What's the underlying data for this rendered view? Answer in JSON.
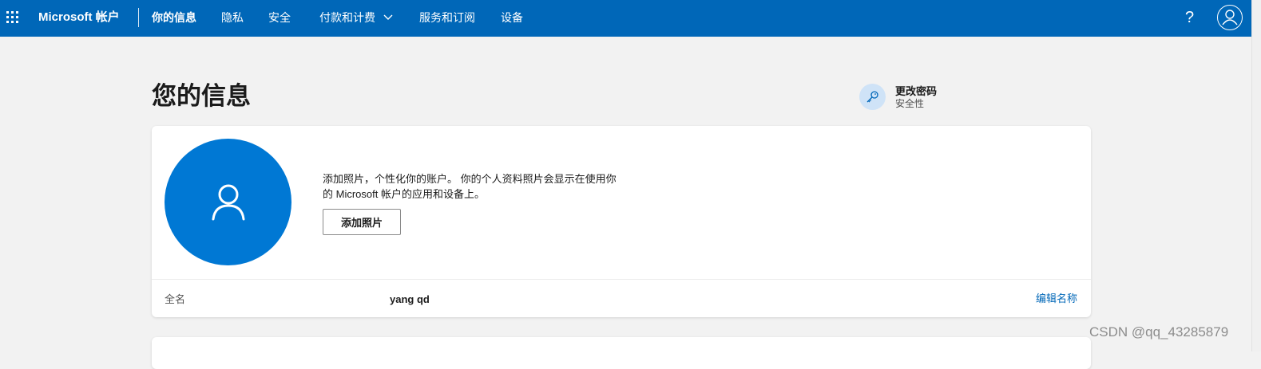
{
  "colors": {
    "topbar": "#0067b8",
    "accent": "#0078d4",
    "link": "#0067b8",
    "background": "#f2f2f2"
  },
  "topbar": {
    "brand": "Microsoft 帐户",
    "nav": [
      {
        "label": "你的信息",
        "active": true
      },
      {
        "label": "隐私"
      },
      {
        "label": "安全"
      },
      {
        "label": "付款和计费",
        "has_dropdown": true
      },
      {
        "label": "服务和订阅"
      },
      {
        "label": "设备"
      }
    ],
    "help": "?",
    "icons": {
      "apps": "waffle-grid-icon",
      "dropdown": "chevron-down-icon",
      "account": "user-avatar-icon"
    }
  },
  "page": {
    "title": "您的信息",
    "change_password": {
      "title": "更改密码",
      "subtitle": "安全性",
      "icon": "key-icon"
    }
  },
  "profile": {
    "photo_description": "添加照片，个性化你的账户。 你的个人资料照片会显示在使用你的 Microsoft 帐户的应用和设备上。",
    "add_photo_button": "添加照片",
    "avatar_icon": "person-icon",
    "full_name_label": "全名",
    "full_name_value": "yang qd",
    "edit_name_link": "编辑名称"
  },
  "watermark": "CSDN @qq_43285879"
}
